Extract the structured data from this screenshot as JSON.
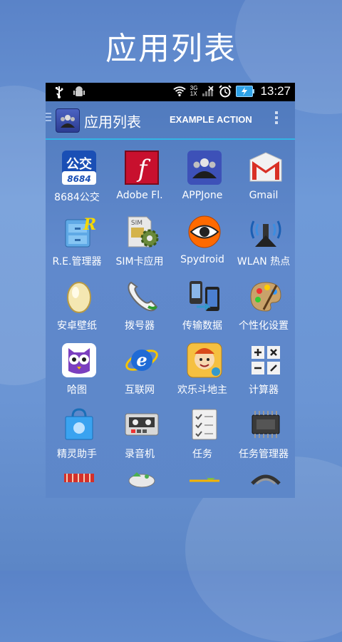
{
  "promo": {
    "title": "应用列表"
  },
  "status_bar": {
    "time": "13:27",
    "network_top": "3G",
    "network_bottom": "1X",
    "icons": [
      "usb-icon",
      "android-debug-icon",
      "wifi-icon",
      "signal-3g-icon",
      "signal-1x-icon",
      "alarm-icon",
      "battery-charging-icon"
    ]
  },
  "action_bar": {
    "title": "应用列表",
    "action_label": "EXAMPLE ACTION",
    "accent_color": "#33b5e5"
  },
  "apps": [
    {
      "label": "8684公交",
      "icon": "bus-8684-icon",
      "icon_text": "公交",
      "icon_subtext": "8684"
    },
    {
      "label": "Adobe Fl.",
      "icon": "adobe-flash-icon",
      "icon_text": "f"
    },
    {
      "label": "APPJone",
      "icon": "appjone-icon"
    },
    {
      "label": "Gmail",
      "icon": "gmail-icon",
      "icon_text": "M"
    },
    {
      "label": "R.E.管理器",
      "icon": "file-cabinet-icon",
      "icon_text": "R"
    },
    {
      "label": "SIM卡应用",
      "icon": "sim-card-gear-icon",
      "icon_text": "SIM"
    },
    {
      "label": "Spydroid",
      "icon": "spydroid-eye-icon"
    },
    {
      "label": "WLAN 热点",
      "icon": "wifi-hotspot-icon"
    },
    {
      "label": "安卓壁纸",
      "icon": "easter-egg-icon"
    },
    {
      "label": "拨号器",
      "icon": "phone-handset-icon"
    },
    {
      "label": "传输数据",
      "icon": "data-transfer-icon"
    },
    {
      "label": "个性化设置",
      "icon": "paint-palette-icon"
    },
    {
      "label": "哈图",
      "icon": "owl-icon"
    },
    {
      "label": "互联网",
      "icon": "internet-explorer-icon",
      "icon_text": "e"
    },
    {
      "label": "欢乐斗地主",
      "icon": "poker-game-icon"
    },
    {
      "label": "计算器",
      "icon": "calculator-icon"
    },
    {
      "label": "精灵助手",
      "icon": "shopping-bag-icon"
    },
    {
      "label": "录音机",
      "icon": "cassette-recorder-icon"
    },
    {
      "label": "任务",
      "icon": "task-checklist-icon"
    },
    {
      "label": "任务管理器",
      "icon": "chip-task-manager-icon"
    },
    {
      "label": "",
      "icon": "partial-red-app-icon"
    },
    {
      "label": "",
      "icon": "partial-green-app-icon"
    },
    {
      "label": "",
      "icon": "partial-star-app-icon"
    },
    {
      "label": "",
      "icon": "partial-dark-app-icon"
    }
  ]
}
